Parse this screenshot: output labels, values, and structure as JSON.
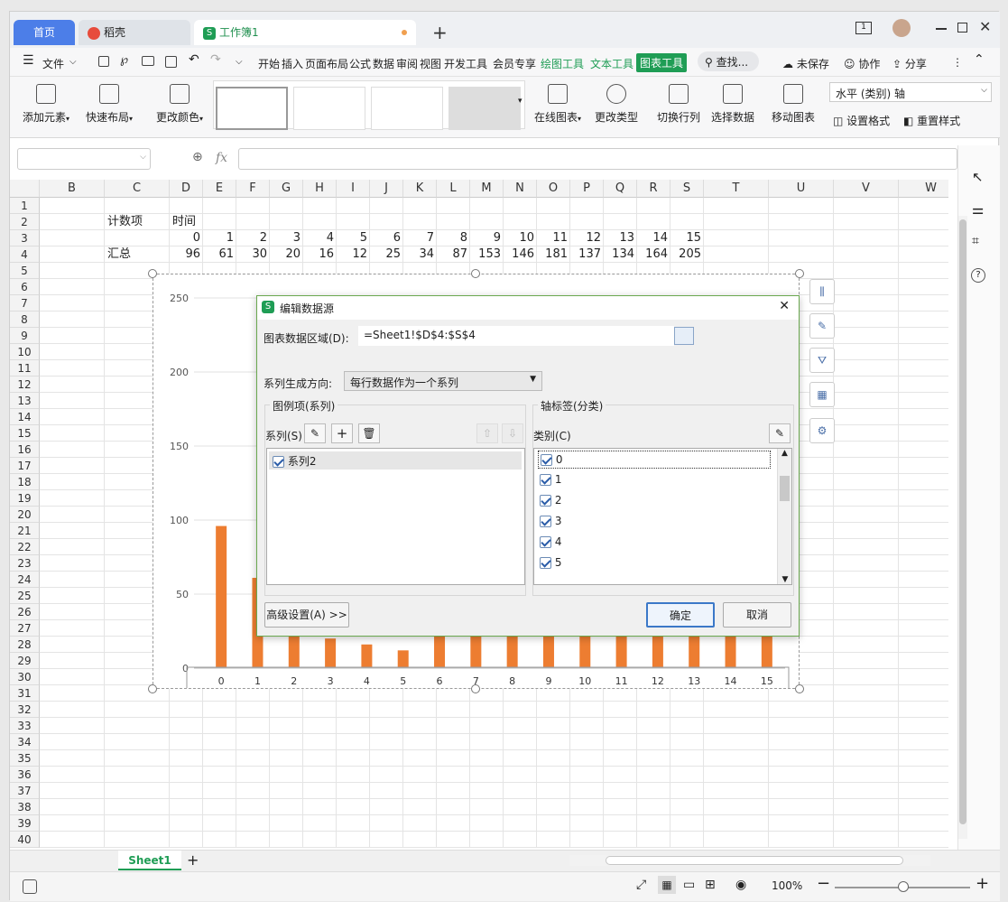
{
  "tabs": {
    "home": "首页",
    "daoke": "稻壳",
    "workbook": "工作簿1"
  },
  "menu": {
    "file": "文件",
    "items": [
      "开始",
      "插入",
      "页面布局",
      "公式",
      "数据",
      "审阅",
      "视图",
      "开发工具",
      "会员专享"
    ],
    "draw_tools": "绘图工具",
    "text_tools": "文本工具",
    "chart_tools": "图表工具",
    "search": "查找...",
    "unsaved": "未保存",
    "collab": "协作",
    "share": "分享"
  },
  "ribbon": {
    "add_element": "添加元素",
    "quick_layout": "快速布局",
    "change_color": "更改颜色",
    "online_chart": "在线图表",
    "change_type": "更改类型",
    "switch_rowcol": "切换行列",
    "select_data": "选择数据",
    "move_chart": "移动图表",
    "axis_select": "水平 (类别) 轴",
    "set_format": "设置格式",
    "reset_style": "重置样式"
  },
  "formula": {
    "fx": "fx"
  },
  "columns": [
    "B",
    "C",
    "D",
    "E",
    "F",
    "G",
    "H",
    "I",
    "J",
    "K",
    "L",
    "M",
    "N",
    "O",
    "P",
    "Q",
    "R",
    "S",
    "T",
    "U",
    "V",
    "W"
  ],
  "sheet": {
    "c2": "计数项",
    "d2": "时间",
    "c4": "汇总",
    "row3": [
      "0",
      "1",
      "2",
      "3",
      "4",
      "5",
      "6",
      "7",
      "8",
      "9",
      "10",
      "11",
      "12",
      "13",
      "14",
      "15"
    ],
    "row4": [
      "96",
      "61",
      "30",
      "20",
      "16",
      "12",
      "25",
      "34",
      "87",
      "153",
      "146",
      "181",
      "137",
      "134",
      "164",
      "205"
    ]
  },
  "chart_data": {
    "type": "bar",
    "categories": [
      "0",
      "1",
      "2",
      "3",
      "4",
      "5",
      "6",
      "7",
      "8",
      "9",
      "10",
      "11",
      "12",
      "13",
      "14",
      "15"
    ],
    "series": [
      {
        "name": "系列2",
        "values": [
          96,
          61,
          30,
          20,
          16,
          12,
          25,
          34,
          87,
          153,
          146,
          181,
          137,
          134,
          164,
          205
        ]
      }
    ],
    "ylim": [
      0,
      250
    ],
    "yticks": [
      "0",
      "50",
      "100",
      "150",
      "200",
      "250"
    ],
    "color": "#ed7d31"
  },
  "dialog": {
    "title": "编辑数据源",
    "range_label": "图表数据区域(D):",
    "range_value": "=Sheet1!$D$4:$S$4",
    "direction_label": "系列生成方向:",
    "direction_value": "每行数据作为一个系列",
    "legend_group": "图例项(系列)",
    "series_label": "系列(S)",
    "series_items": [
      "系列2"
    ],
    "axis_group": "轴标签(分类)",
    "category_label": "类别(C)",
    "category_items": [
      "0",
      "1",
      "2",
      "3",
      "4",
      "5"
    ],
    "advanced": "高级设置(A) >>",
    "ok": "确定",
    "cancel": "取消"
  },
  "statusbar": {
    "sheet_tab": "Sheet1",
    "zoom": "100%"
  }
}
